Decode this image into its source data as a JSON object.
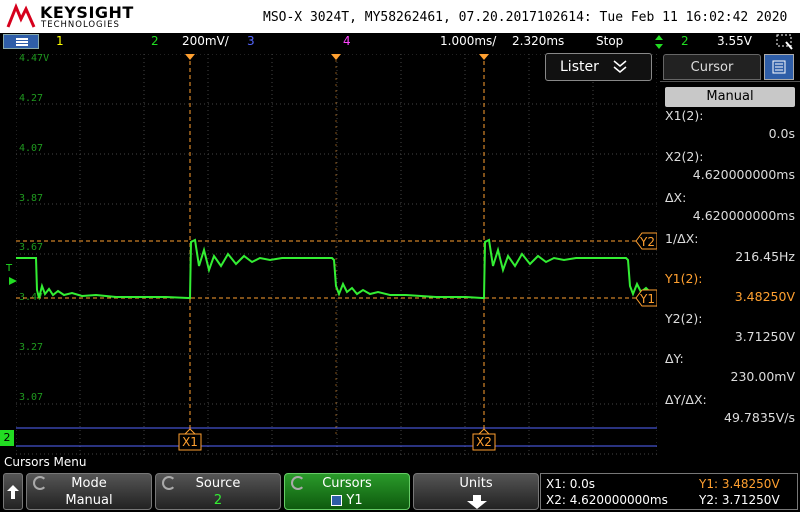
{
  "brand": {
    "name": "KEYSIGHT",
    "sub": "TECHNOLOGIES"
  },
  "scope_info": "MSO-X 3024T, MY58262461, 07.20.2017102614: Tue Feb 11 16:02:42 2020",
  "status": {
    "ch1": "1",
    "ch2": "2",
    "ch2_scale": "200mV/",
    "ch3": "3",
    "ch4": "4",
    "timebase": "1.000ms/",
    "delay": "2.320ms",
    "run_state": "Stop",
    "trig_source": "2",
    "trig_level": "3.55V",
    "trig_icon": "trigger-edge-icon"
  },
  "grid": {
    "y_labels": [
      "4.47V",
      "4.27",
      "4.07",
      "3.87",
      "3.67",
      "3.47",
      "3.27",
      "3.07"
    ],
    "x1_label": "X1",
    "x2_label": "X2",
    "y1_label": "Y1",
    "y2_label": "Y2",
    "ch2_marker": "2",
    "trig_marker": "T"
  },
  "lister": {
    "label": "Lister"
  },
  "cursor_panel": {
    "tab_label": "Cursor",
    "mode_value": "Manual",
    "measurements": [
      {
        "label": "X1(2):",
        "value": "0.0s"
      },
      {
        "label": "X2(2):",
        "value": "4.620000000ms"
      },
      {
        "label": "ΔX:",
        "value": "4.620000000ms"
      },
      {
        "label": "1/ΔX:",
        "value": "216.45Hz"
      },
      {
        "label": "Y1(2):",
        "value": "3.48250V"
      },
      {
        "label": "Y2(2):",
        "value": "3.71250V"
      },
      {
        "label": "ΔY:",
        "value": "230.00mV"
      },
      {
        "label": "ΔY/ΔX:",
        "value": "49.7835V/s"
      }
    ]
  },
  "menu": {
    "title": "Cursors Menu",
    "mode": {
      "label": "Mode",
      "value": "Manual"
    },
    "source": {
      "label": "Source",
      "value": "2"
    },
    "cursors": {
      "label": "Cursors",
      "value": "Y1"
    },
    "units": {
      "label": "Units"
    }
  },
  "summary": {
    "x1": "X1:  0.0s",
    "x2": "X2:  4.620000000ms",
    "y1": "Y1: 3.48250V",
    "y2": "Y2: 3.71250V"
  },
  "colors": {
    "ch1": "#ffff00",
    "ch2": "#22dd22",
    "ch3": "#5566ff",
    "ch4": "#ff44ff",
    "cursor": "#ffa030",
    "trace": "#33ee33",
    "grid": "#555555"
  }
}
